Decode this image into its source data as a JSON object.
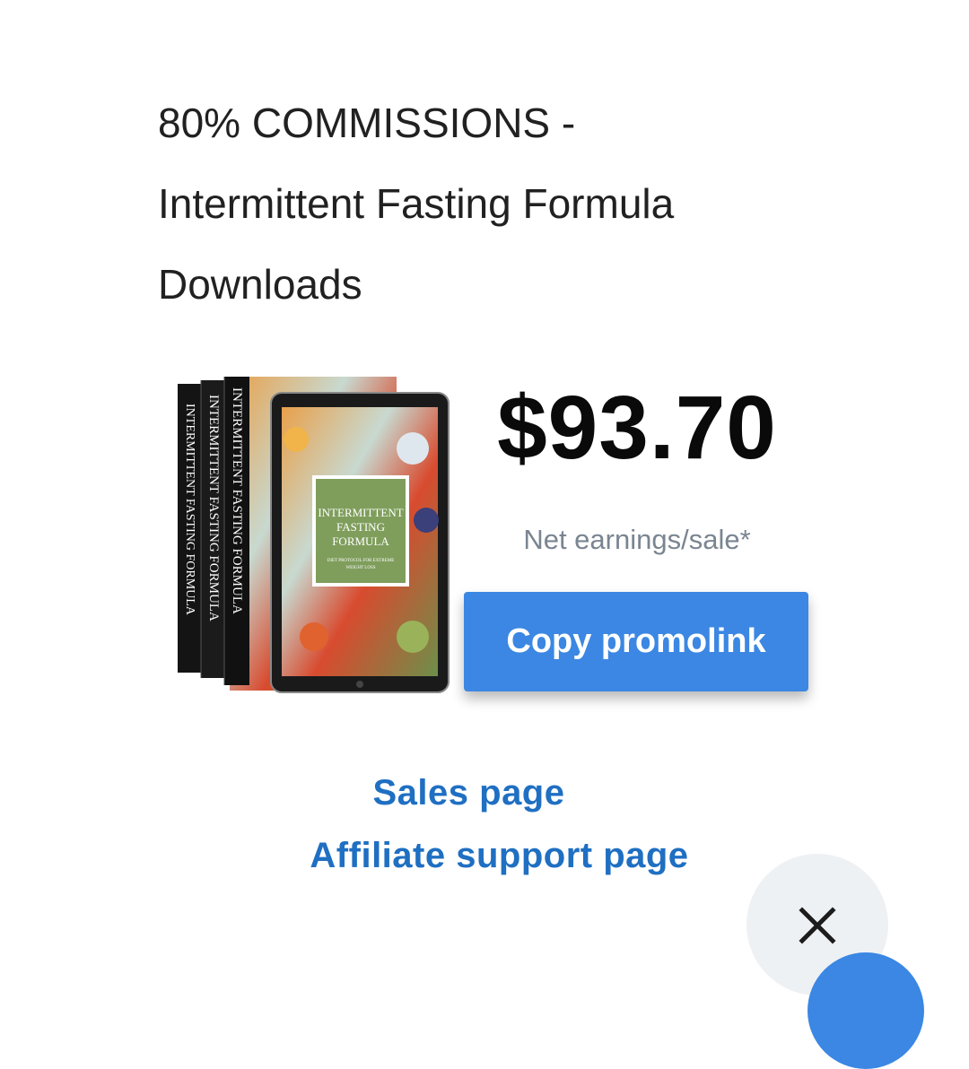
{
  "title_lines": [
    "80% COMMISSIONS -",
    "Intermittent Fasting Formula",
    "Downloads"
  ],
  "product_image": {
    "spine_text": "INTERMITTENT FASTING FORMULA",
    "cover_title_1": "INTERMITTENT",
    "cover_title_2": "FASTING",
    "cover_title_3": "FORMULA",
    "cover_subtitle_1": "DIET PROTOCOL FOR EXTREME",
    "cover_subtitle_2": "WEIGHT LOSS"
  },
  "price": "$93.70",
  "net_label": "Net earnings/sale*",
  "copy_button_label": "Copy promolink",
  "links": {
    "sales": "Sales page",
    "support": "Affiliate support page"
  },
  "icons": {
    "close": "close-icon"
  },
  "colors": {
    "accent": "#3b87e3",
    "link": "#1f6fc2",
    "muted": "#7a8591"
  }
}
